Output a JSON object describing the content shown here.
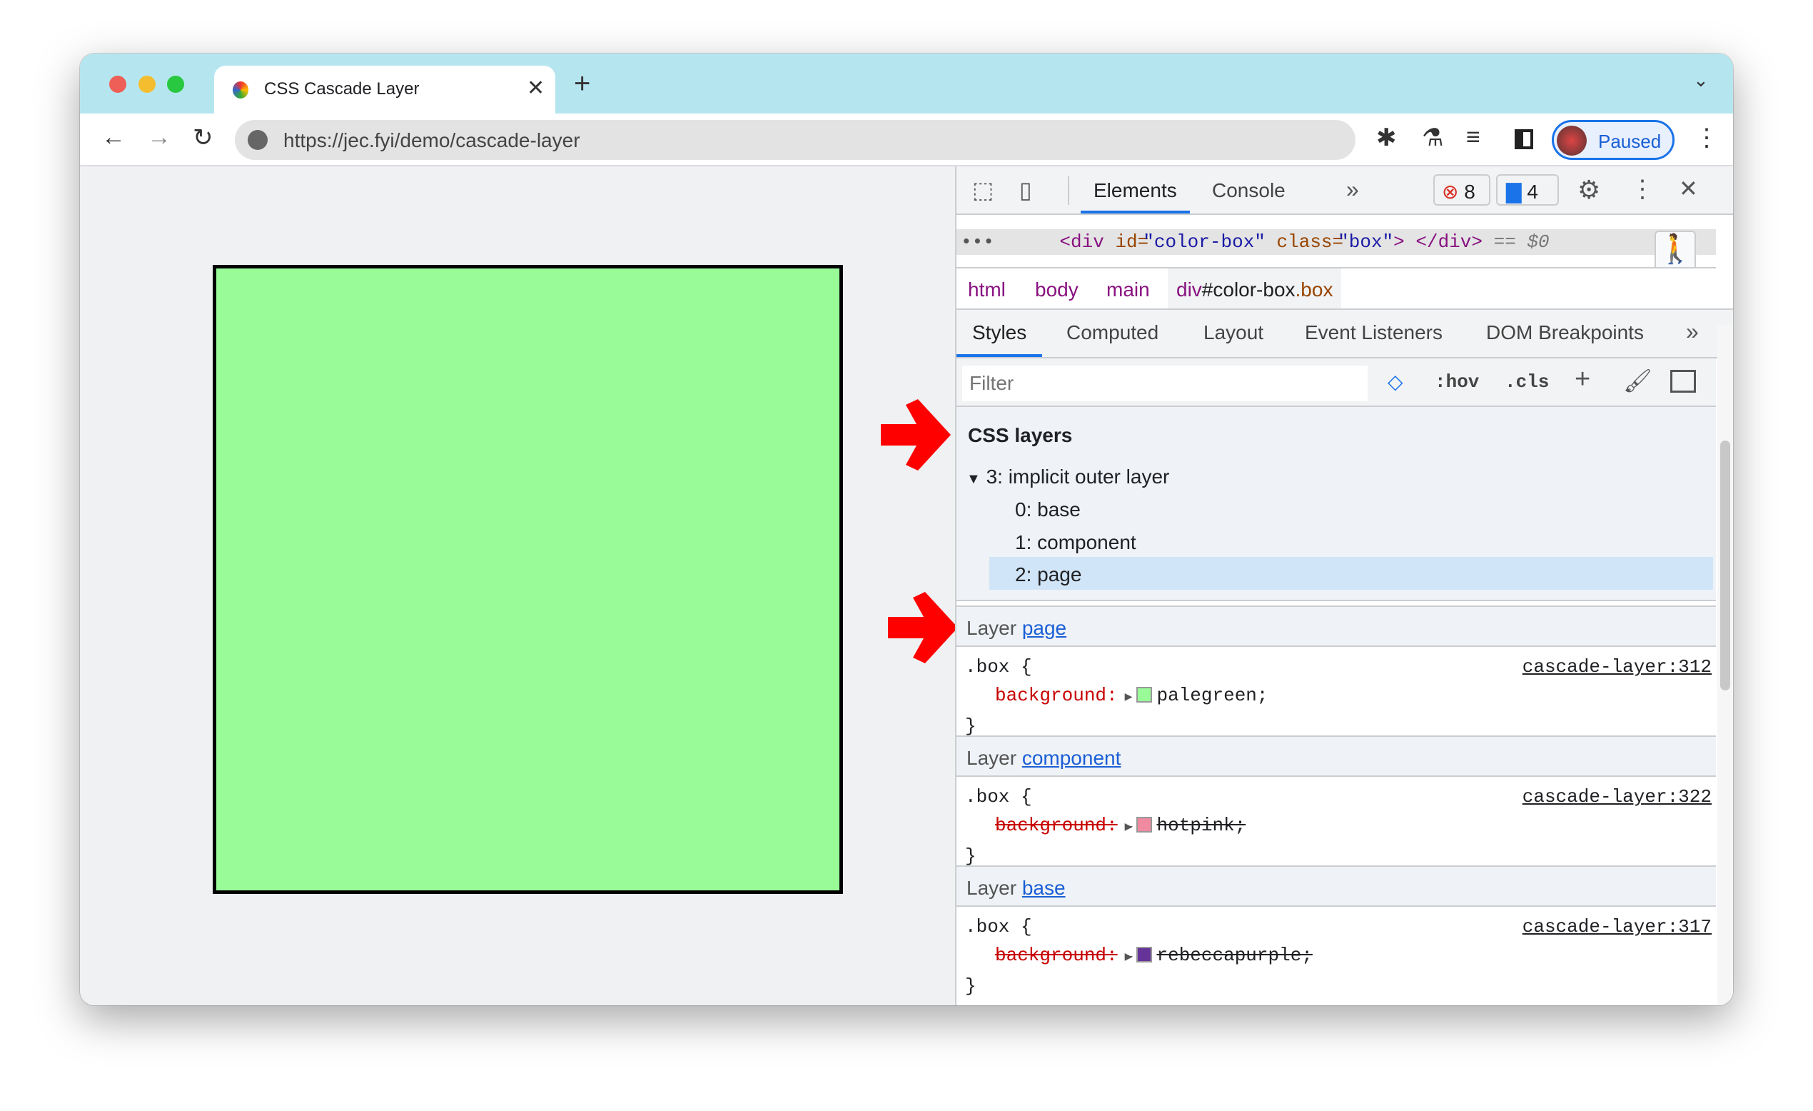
{
  "browser": {
    "tab_title": "CSS Cascade Layer",
    "url": "https://jec.fyi/demo/cascade-layer",
    "profile_label": "Paused",
    "icons": [
      "back-icon",
      "forward-icon",
      "reload-icon",
      "site-info-icon",
      "extensions-icon",
      "labs-icon",
      "media-icon",
      "side-panel-icon",
      "kebab-icon"
    ]
  },
  "page": {
    "box_color": "#98fb98",
    "box_border": "#000000"
  },
  "devtools": {
    "tabs": [
      "Elements",
      "Console"
    ],
    "active_tab": "Elements",
    "error_count": "8",
    "message_count": "4",
    "dom": {
      "ellipsis": "•••",
      "tag_open": "<div",
      "attr1_name": "id=",
      "attr1_value": "\"color-box\"",
      "attr2_name": "class=",
      "attr2_value": "\"box\"",
      "tag_close": ">",
      "end_tag": "</div>",
      "eq": "== $0"
    },
    "breadcrumbs": [
      "html",
      "body",
      "main"
    ],
    "breadcrumb_selected": {
      "tag": "div",
      "id": "#color-box",
      "cls": ".box"
    },
    "subtabs": [
      "Styles",
      "Computed",
      "Layout",
      "Event Listeners",
      "DOM Breakpoints"
    ],
    "filter_placeholder": "Filter",
    "hov": ":hov",
    "cls": ".cls",
    "layers": {
      "title": "CSS layers",
      "root": "3: implicit outer layer",
      "children": [
        "0: base",
        "1: component",
        "2: page"
      ],
      "selected": "2: page"
    },
    "rules": [
      {
        "layer_prefix": "Layer",
        "layer": "page",
        "selector": ".box {",
        "source": "cascade-layer:312",
        "prop": "background:",
        "value": "palegreen;",
        "swatch": "#98fb98",
        "overridden": false,
        "close": "}"
      },
      {
        "layer_prefix": "Layer",
        "layer": "component",
        "selector": ".box {",
        "source": "cascade-layer:322",
        "prop": "background:",
        "value": "hotpink;",
        "swatch": "#f08aa0",
        "overridden": true,
        "close": "}"
      },
      {
        "layer_prefix": "Layer",
        "layer": "base",
        "selector": ".box {",
        "source": "cascade-layer:317",
        "prop": "background:",
        "value": "rebeccapurple;",
        "swatch": "#663399",
        "overridden": true,
        "close": "}"
      }
    ]
  },
  "colors": {
    "tabbar": "#b5e6f0",
    "accent": "#1a73e8",
    "annotation_arrow": "#ff0000"
  }
}
